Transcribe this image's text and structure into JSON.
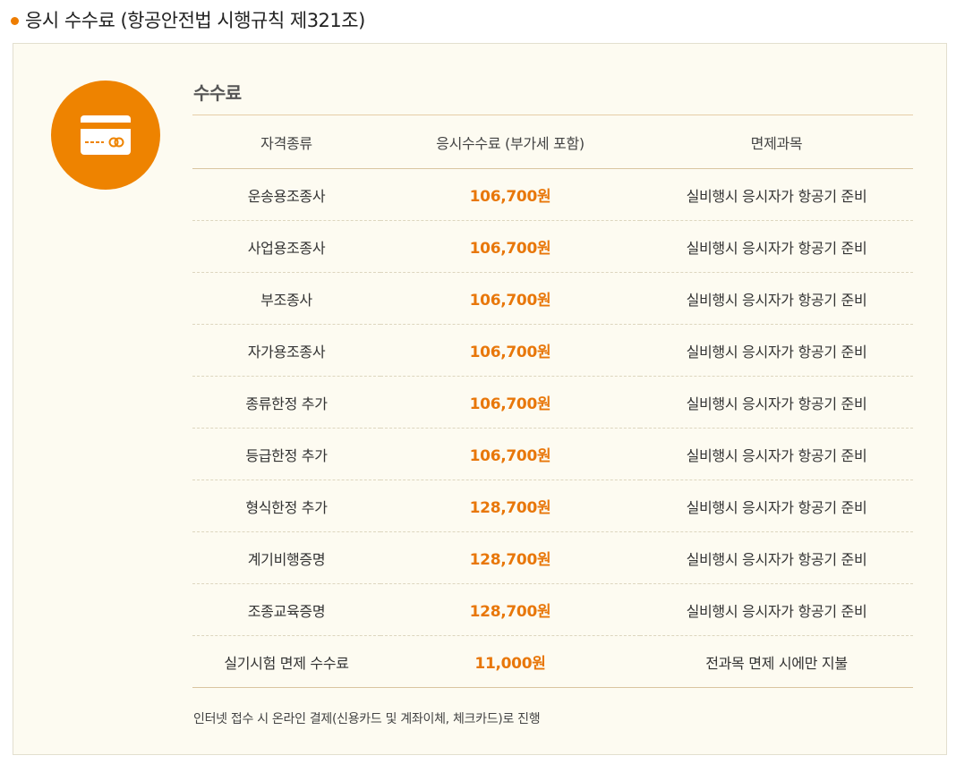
{
  "heading": "응시 수수료 (항공안전법 시행규칙 제321조)",
  "section_title": "수수료",
  "table": {
    "headers": [
      "자격종류",
      "응시수수료 (부가세 포함)",
      "면제과목"
    ],
    "rows": [
      [
        "운송용조종사",
        "106,700원",
        "실비행시 응시자가 항공기 준비"
      ],
      [
        "사업용조종사",
        "106,700원",
        "실비행시 응시자가 항공기 준비"
      ],
      [
        "부조종사",
        "106,700원",
        "실비행시 응시자가 항공기 준비"
      ],
      [
        "자가용조종사",
        "106,700원",
        "실비행시 응시자가 항공기 준비"
      ],
      [
        "종류한정 추가",
        "106,700원",
        "실비행시 응시자가 항공기 준비"
      ],
      [
        "등급한정 추가",
        "106,700원",
        "실비행시 응시자가 항공기 준비"
      ],
      [
        "형식한정 추가",
        "128,700원",
        "실비행시 응시자가 항공기 준비"
      ],
      [
        "계기비행증명",
        "128,700원",
        "실비행시 응시자가 항공기 준비"
      ],
      [
        "조종교육증명",
        "128,700원",
        "실비행시 응시자가 항공기 준비"
      ],
      [
        "실기시험 면제 수수료",
        "11,000원",
        "전과목 면제 시에만 지불"
      ]
    ]
  },
  "note": "인터넷 접수 시 온라인 결제(신용카드 및 계좌이체, 체크카드)로 진행",
  "icon": "credit-card-icon",
  "colors": {
    "accent": "#ee8300",
    "fee_text": "#e8770a",
    "panel_bg": "#fdfbf1"
  }
}
